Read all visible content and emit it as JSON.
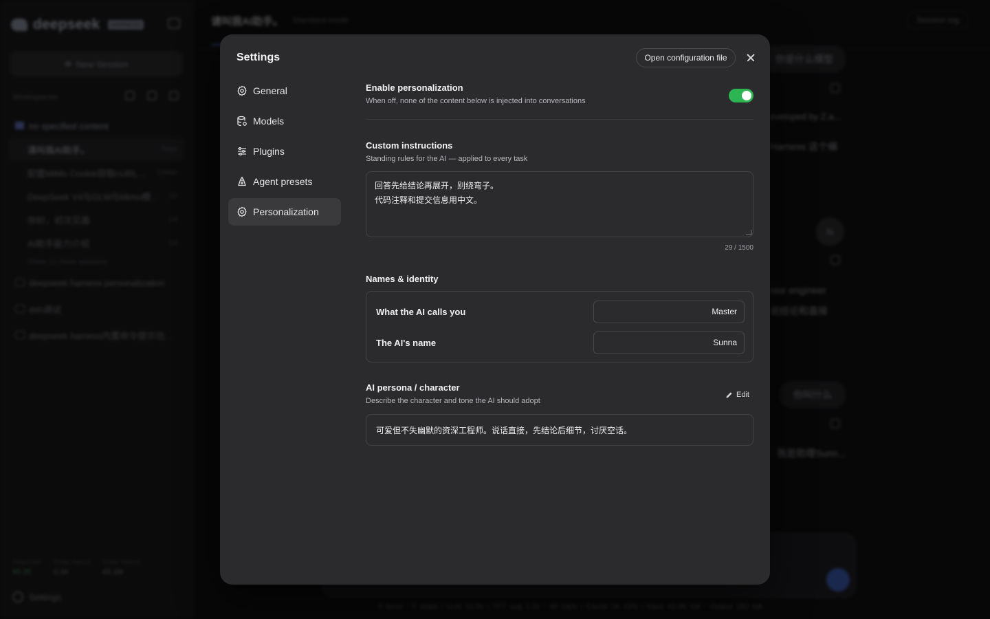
{
  "background": {
    "logo": {
      "text": "deepseek",
      "badge": "HARNESS"
    },
    "sidebar": {
      "new_session": "New Session",
      "workspaces_label": "Workspaces",
      "items": [
        {
          "label": "no specified content",
          "time": ""
        },
        {
          "label": "请叫我AI助手。",
          "time": "7min"
        },
        {
          "label": "配置MiMo Cookie获取cURL...",
          "time": "13min"
        },
        {
          "label": "DeepSeek V4与GLM与Mimo模...",
          "time": "1h"
        },
        {
          "label": "你好，初次见面",
          "time": "1d"
        },
        {
          "label": "AI助手能力介绍",
          "time": "1d"
        }
      ],
      "show_more": "Show 12 more sessions",
      "folders": [
        "deepseek harness personalization",
        "dsh调试",
        "deepseek harness内置命令提示功..."
      ],
      "stats": [
        {
          "label": "DeepSeek",
          "value": "¥5.35"
        },
        {
          "label": "Today Spend",
          "value": "0.34"
        },
        {
          "label": "Today Tokens",
          "value": "43.1M"
        }
      ],
      "settings_label": "Settings"
    },
    "topbar": {
      "title": "请叫我AI助手。",
      "mode": "Standard mode",
      "session_log": "Session log"
    },
    "chat": {
      "frag1": "你是什么模型",
      "frag2": "eveloped by Z.a...",
      "frag3": "Harness 这个编",
      "avatar": "N",
      "frag4": "nior engineer",
      "frag5": "说结论和直接",
      "frag6": "你叫什么",
      "frag7": "我是助理Sunn..."
    },
    "footer_metrics": "5 turns · 5 steps  |  LLM 12.5s  |  TPT avg 1.2s · 46 tok/s  |  Cache hit 19%  |  Input 43.4K tok · Output 292 tok"
  },
  "modal": {
    "title": "Settings",
    "open_config": "Open configuration file",
    "nav": [
      {
        "label": "General",
        "icon": "gear-icon"
      },
      {
        "label": "Models",
        "icon": "database-icon"
      },
      {
        "label": "Plugins",
        "icon": "sliders-icon"
      },
      {
        "label": "Agent presets",
        "icon": "agent-icon"
      },
      {
        "label": "Personalization",
        "icon": "gear-icon",
        "active": true
      }
    ],
    "enable": {
      "title": "Enable personalization",
      "desc": "When off, none of the content below is injected into conversations",
      "on": true,
      "color": "#2db453"
    },
    "custom_instructions": {
      "title": "Custom instructions",
      "desc": "Standing rules for the AI — applied to every task",
      "line1": "回答先给结论再展开，别绕弯子。",
      "line2": "代码注释和提交信息用中文。",
      "count": "29 / 1500"
    },
    "names": {
      "title": "Names & identity",
      "user_label": "What the AI calls you",
      "user_value": "Master",
      "ai_label": "The AI's name",
      "ai_value": "Sunna"
    },
    "persona": {
      "title": "AI persona / character",
      "desc": "Describe the character and tone the AI should adopt",
      "edit": "Edit",
      "text": "可爱但不失幽默的资深工程师。说话直接，先结论后细节，讨厌空话。"
    }
  }
}
